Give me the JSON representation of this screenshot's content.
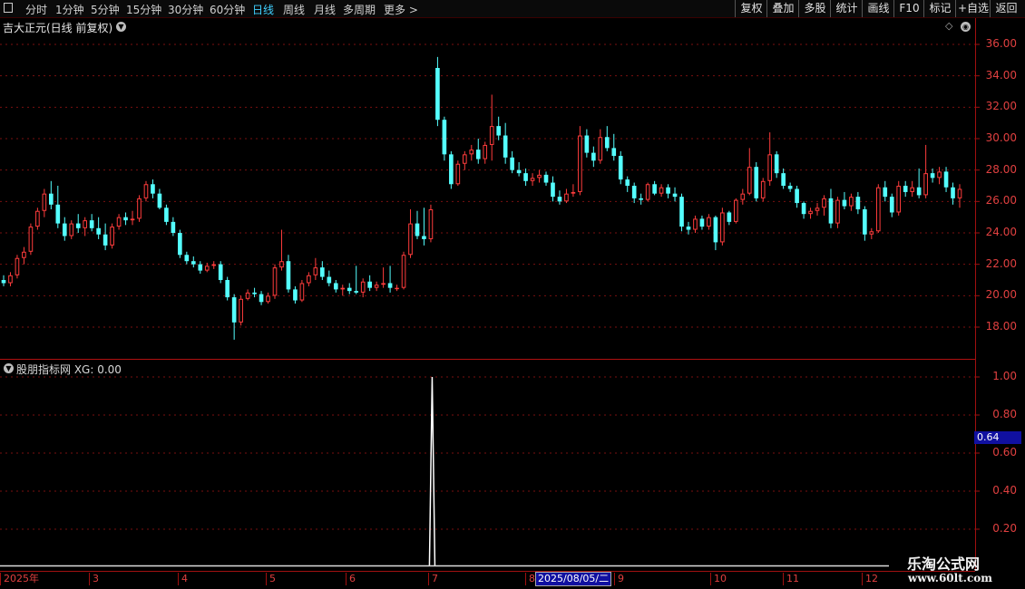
{
  "toolbar": {
    "left_items": [
      {
        "label": "分时",
        "active": false
      },
      {
        "label": "1分钟",
        "active": false
      },
      {
        "label": "5分钟",
        "active": false
      },
      {
        "label": "15分钟",
        "active": false
      },
      {
        "label": "30分钟",
        "active": false
      },
      {
        "label": "60分钟",
        "active": false
      },
      {
        "label": "日线",
        "active": true
      },
      {
        "label": "周线",
        "active": false
      },
      {
        "label": "月线",
        "active": false
      },
      {
        "label": "多周期",
        "active": false
      },
      {
        "label": "更多 >",
        "active": false
      }
    ],
    "right_items": [
      "复权",
      "叠加",
      "多股",
      "统计",
      "画线",
      "F10",
      "标记",
      "+自选",
      "返回"
    ]
  },
  "main_chart": {
    "title": "吉大正元(日线 前复权)",
    "y_ticks": [
      "36.00",
      "34.00",
      "32.00",
      "30.00",
      "28.00",
      "26.00",
      "24.00",
      "22.00",
      "20.00",
      "18.00"
    ]
  },
  "indicator": {
    "title": "股朋指标网  XG: 0.00",
    "y_ticks": [
      "1.00",
      "0.80",
      "0.60",
      "0.40",
      "0.20"
    ],
    "cursor_value": "0.64"
  },
  "date_axis": {
    "labels": [
      "2025年",
      "3",
      "4",
      "5",
      "6",
      "7",
      "8",
      "9",
      "10",
      "11",
      "12"
    ],
    "cursor_date": "2025/08/05/二"
  },
  "watermark": {
    "line1": "乐淘公式网",
    "line2": "www.60lt.com"
  },
  "colors": {
    "up": "#ff3c3c",
    "down": "#54ffff",
    "axis": "#a01010",
    "grid": "#7a1010",
    "badge": "#1010a0"
  },
  "chart_data": {
    "type": "candlestick",
    "ylim": [
      16.4,
      37.2
    ],
    "ohlc": [
      [
        21,
        21.3,
        20.6,
        20.8
      ],
      [
        20.8,
        21.5,
        20.6,
        21.3
      ],
      [
        21.3,
        22.6,
        21.1,
        22.4
      ],
      [
        22.4,
        23.1,
        22,
        22.8
      ],
      [
        22.8,
        24.6,
        22.6,
        24.4
      ],
      [
        24.4,
        25.6,
        24.2,
        25.4
      ],
      [
        25.4,
        26.8,
        25,
        26.5
      ],
      [
        26.5,
        27.3,
        25.5,
        25.8
      ],
      [
        25.8,
        27,
        24.3,
        24.6
      ],
      [
        24.6,
        25,
        23.5,
        23.8
      ],
      [
        23.8,
        24.8,
        23.6,
        24.6
      ],
      [
        24.6,
        25.2,
        24,
        24.3
      ],
      [
        24.3,
        25,
        23.8,
        24.8
      ],
      [
        24.8,
        25.2,
        24.1,
        24.3
      ],
      [
        24.3,
        25,
        23.6,
        23.9
      ],
      [
        23.9,
        24.6,
        22.9,
        23.2
      ],
      [
        23.2,
        24.6,
        23,
        24.4
      ],
      [
        24.4,
        25.2,
        24.2,
        25
      ],
      [
        25,
        25.3,
        24.5,
        24.8
      ],
      [
        24.8,
        25.4,
        24.5,
        24.9
      ],
      [
        24.9,
        26.4,
        24.7,
        26.2
      ],
      [
        26.2,
        27.3,
        26,
        27.1
      ],
      [
        27.1,
        27.4,
        26.2,
        26.5
      ],
      [
        26.5,
        26.8,
        25.5,
        25.6
      ],
      [
        25.6,
        25.8,
        24.5,
        24.7
      ],
      [
        24.7,
        25,
        23.8,
        24
      ],
      [
        24,
        24.2,
        22.4,
        22.6
      ],
      [
        22.6,
        22.8,
        22,
        22.2
      ],
      [
        22.2,
        22.5,
        21.8,
        22
      ],
      [
        22,
        22.2,
        21.4,
        21.6
      ],
      [
        21.6,
        22.1,
        21.5,
        21.9
      ],
      [
        21.9,
        22.2,
        21.7,
        22
      ],
      [
        22,
        22.2,
        20.8,
        21
      ],
      [
        21,
        21.2,
        19.7,
        19.9
      ],
      [
        19.9,
        20.1,
        17.2,
        18.3
      ],
      [
        18.3,
        20,
        18.1,
        19.8
      ],
      [
        19.8,
        20.4,
        19.7,
        20.2
      ],
      [
        20.2,
        20.5,
        19.9,
        20.1
      ],
      [
        20.1,
        20.3,
        19.4,
        19.6
      ],
      [
        19.6,
        20.2,
        19.5,
        20
      ],
      [
        20,
        22,
        19.8,
        21.8
      ],
      [
        21.8,
        24.2,
        21.6,
        22.2
      ],
      [
        22.2,
        22.6,
        20.2,
        20.4
      ],
      [
        20.4,
        20.6,
        19.5,
        19.7
      ],
      [
        19.7,
        21,
        19.6,
        20.8
      ],
      [
        20.8,
        21.5,
        20.6,
        21.3
      ],
      [
        21.3,
        22.4,
        21,
        21.8
      ],
      [
        21.8,
        22.2,
        21,
        21.2
      ],
      [
        21.2,
        21.6,
        20.6,
        20.8
      ],
      [
        20.8,
        21,
        20.2,
        20.4
      ],
      [
        20.4,
        20.7,
        20,
        20.5
      ],
      [
        20.5,
        20.8,
        20.1,
        20.3
      ],
      [
        20.3,
        21.9,
        20.1,
        20.2
      ],
      [
        20.2,
        21.1,
        19.9,
        20.9
      ],
      [
        20.9,
        21.3,
        20.3,
        20.5
      ],
      [
        20.5,
        20.9,
        20.3,
        20.7
      ],
      [
        20.7,
        21.8,
        20.5,
        20.8
      ],
      [
        20.8,
        21.9,
        20.2,
        20.5
      ],
      [
        20.5,
        20.7,
        20.3,
        20.5
      ],
      [
        20.5,
        22.8,
        20.4,
        22.6
      ],
      [
        22.6,
        25.5,
        22.4,
        24.6
      ],
      [
        24.6,
        25.4,
        23.6,
        23.8
      ],
      [
        23.8,
        25.6,
        23.2,
        23.6
      ],
      [
        23.6,
        25.8,
        23.4,
        25.5
      ],
      [
        34.5,
        35.2,
        30.8,
        31.2
      ],
      [
        31.2,
        31.4,
        28.6,
        29
      ],
      [
        29,
        29.2,
        26.8,
        27.1
      ],
      [
        27.1,
        28.6,
        27,
        28.4
      ],
      [
        28.4,
        29.2,
        28,
        29
      ],
      [
        29,
        29.6,
        28.6,
        29.3
      ],
      [
        29.3,
        30,
        28.4,
        28.7
      ],
      [
        28.7,
        29.8,
        28.4,
        29.6
      ],
      [
        29.6,
        32.8,
        28.6,
        30.8
      ],
      [
        30.8,
        31.4,
        29.9,
        30.2
      ],
      [
        30.2,
        31,
        28.4,
        28.8
      ],
      [
        28.8,
        29.2,
        27.8,
        28
      ],
      [
        28,
        28.5,
        27.6,
        27.8
      ],
      [
        27.8,
        28.1,
        27,
        27.3
      ],
      [
        27.3,
        27.8,
        27,
        27.5
      ],
      [
        27.5,
        28,
        27.2,
        27.7
      ],
      [
        27.7,
        27.9,
        27,
        27.2
      ],
      [
        27.2,
        27.6,
        26,
        26.3
      ],
      [
        26.3,
        26.7,
        25.8,
        26
      ],
      [
        26,
        26.8,
        25.9,
        26.5
      ],
      [
        26.5,
        27.1,
        26.3,
        26.6
      ],
      [
        26.6,
        30.8,
        26.4,
        30.2
      ],
      [
        30.2,
        30.6,
        28.8,
        29.1
      ],
      [
        29.1,
        29.5,
        28.2,
        28.6
      ],
      [
        28.6,
        30.6,
        28.4,
        30.1
      ],
      [
        30.1,
        30.8,
        29.2,
        29.4
      ],
      [
        29.4,
        30.3,
        28.6,
        28.9
      ],
      [
        28.9,
        29.2,
        27.1,
        27.4
      ],
      [
        27.4,
        27.6,
        26.6,
        27
      ],
      [
        27,
        27.2,
        25.9,
        26.2
      ],
      [
        26.2,
        26.5,
        25.8,
        26.1
      ],
      [
        26.1,
        27.2,
        26,
        27.1
      ],
      [
        27.1,
        27.3,
        26.4,
        26.5
      ],
      [
        26.5,
        27.1,
        26.3,
        26.9
      ],
      [
        26.9,
        27.1,
        26.2,
        26.5
      ],
      [
        26.5,
        26.9,
        26,
        26.3
      ],
      [
        26.3,
        26.5,
        24.1,
        24.4
      ],
      [
        24.4,
        24.7,
        23.9,
        24.2
      ],
      [
        24.2,
        25.1,
        24,
        24.9
      ],
      [
        24.9,
        25.1,
        24.2,
        24.4
      ],
      [
        24.4,
        25.2,
        24.2,
        25
      ],
      [
        25,
        25.1,
        22.9,
        23.4
      ],
      [
        23.4,
        25.6,
        23.2,
        25.3
      ],
      [
        25.3,
        25.4,
        24.5,
        24.7
      ],
      [
        24.7,
        26.2,
        24.6,
        26.1
      ],
      [
        26.1,
        26.8,
        25.8,
        26.5
      ],
      [
        26.5,
        29.4,
        26.4,
        28.2
      ],
      [
        28.2,
        28.5,
        26,
        26.2
      ],
      [
        26.2,
        27.5,
        26,
        27.3
      ],
      [
        27.3,
        30.4,
        27,
        29
      ],
      [
        29,
        29.2,
        27.5,
        27.8
      ],
      [
        27.8,
        28.1,
        26.8,
        27
      ],
      [
        27,
        27.2,
        26.6,
        26.8
      ],
      [
        26.8,
        27,
        25.6,
        25.9
      ],
      [
        25.9,
        26,
        24.9,
        25.2
      ],
      [
        25.2,
        25.6,
        24.9,
        25.4
      ],
      [
        25.4,
        25.9,
        25.1,
        25.6
      ],
      [
        25.6,
        26.4,
        25.1,
        26.2
      ],
      [
        26.2,
        26.8,
        24.3,
        24.6
      ],
      [
        24.6,
        26.3,
        24.3,
        26.1
      ],
      [
        26.1,
        26.6,
        25.5,
        25.7
      ],
      [
        25.7,
        26.5,
        25.4,
        26.3
      ],
      [
        26.3,
        26.6,
        25.2,
        25.5
      ],
      [
        25.5,
        25.7,
        23.5,
        23.9
      ],
      [
        23.9,
        24.3,
        23.6,
        24.1
      ],
      [
        24.1,
        27.1,
        24,
        26.9
      ],
      [
        26.9,
        27.3,
        26,
        26.3
      ],
      [
        26.3,
        26.5,
        25,
        25.3
      ],
      [
        25.3,
        27.3,
        25.1,
        27
      ],
      [
        27,
        27.3,
        26.3,
        26.6
      ],
      [
        26.6,
        27.3,
        26.3,
        26.9
      ],
      [
        26.9,
        28.1,
        26.2,
        26.4
      ],
      [
        26.4,
        29.6,
        26.2,
        27.8
      ],
      [
        27.8,
        28.1,
        27.2,
        27.5
      ],
      [
        27.5,
        28.2,
        27.1,
        27.9
      ],
      [
        27.9,
        28.2,
        26.6,
        26.9
      ],
      [
        26.9,
        27.2,
        25.8,
        26.2
      ],
      [
        26.2,
        27.1,
        25.6,
        26.8
      ]
    ],
    "xg": {
      "spike_value": 1.0,
      "ylim": [
        0,
        1.05
      ]
    }
  }
}
